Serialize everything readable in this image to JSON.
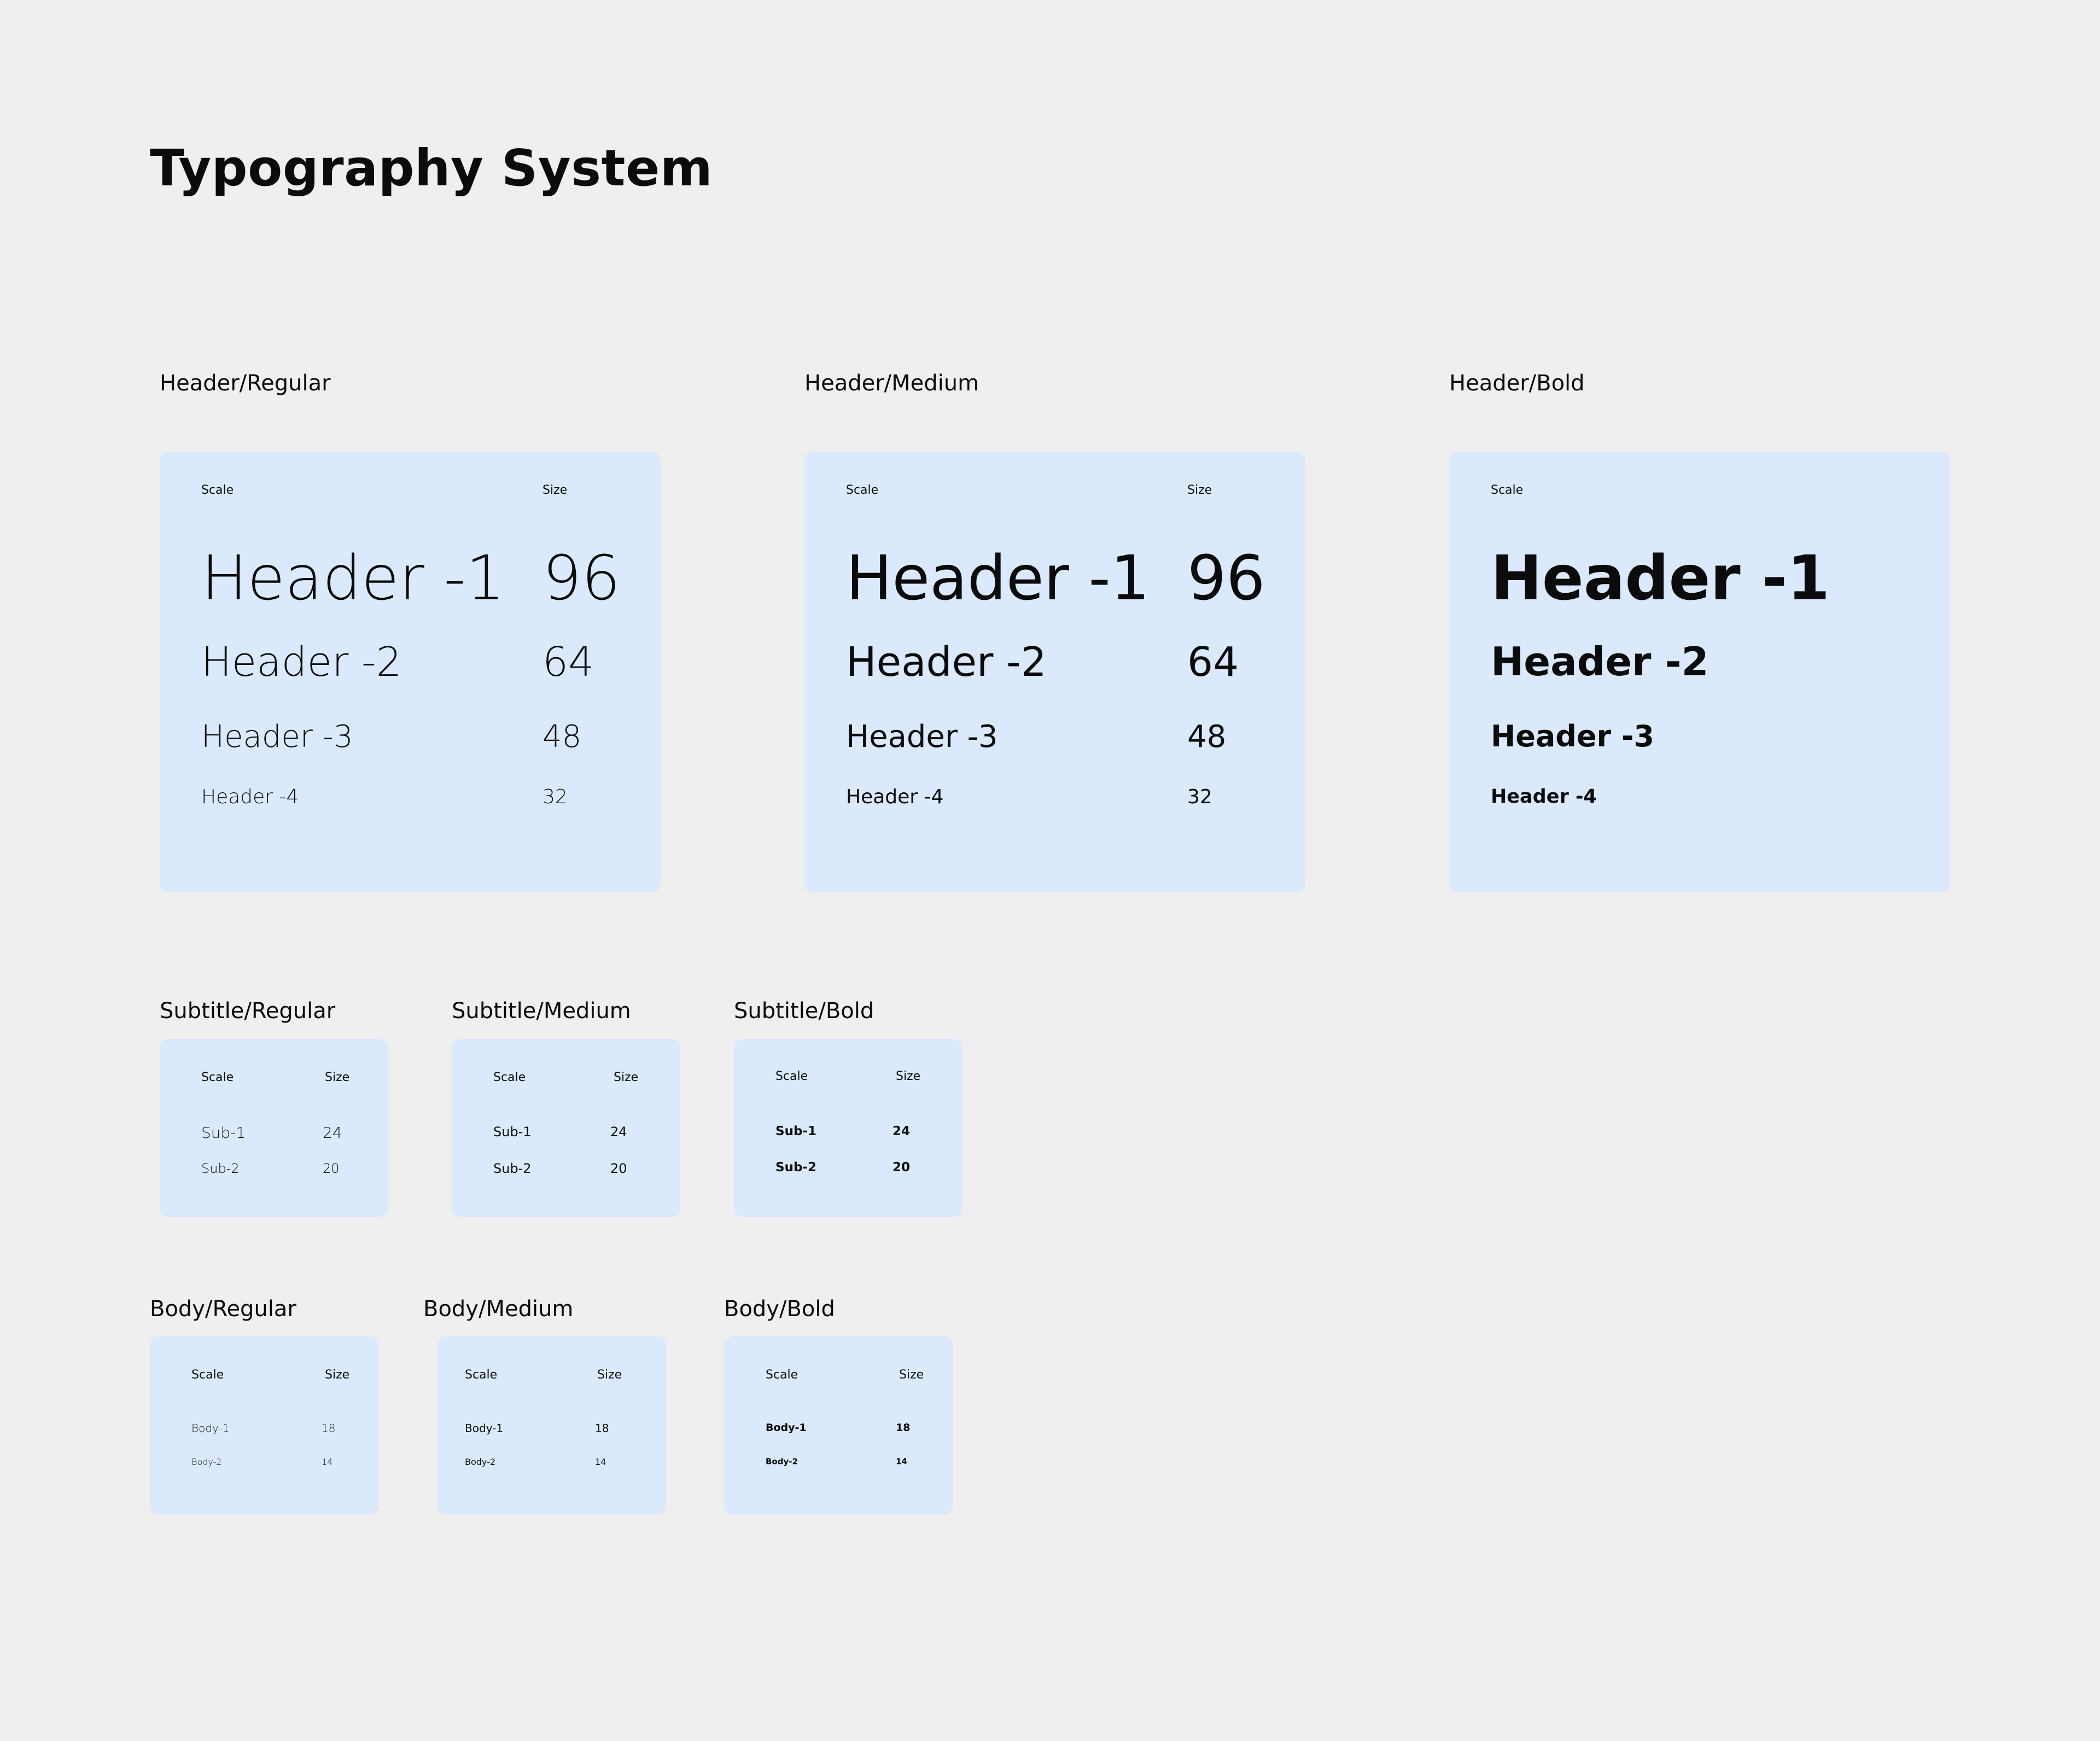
{
  "title": "Typography System",
  "header_sections": [
    {
      "label": "Header/Regular",
      "col_scale": "Scale",
      "col_size": "Size",
      "rows": [
        {
          "name": "Header -1",
          "size": "96"
        },
        {
          "name": "Header -2",
          "size": "64"
        },
        {
          "name": "Header -3",
          "size": "48"
        },
        {
          "name": "Header -4",
          "size": "32"
        }
      ]
    },
    {
      "label": "Header/Medium",
      "col_scale": "Scale",
      "col_size": "Size",
      "rows": [
        {
          "name": "Header -1",
          "size": "96"
        },
        {
          "name": "Header -2",
          "size": "64"
        },
        {
          "name": "Header -3",
          "size": "48"
        },
        {
          "name": "Header -4",
          "size": "32"
        }
      ]
    },
    {
      "label": "Header/Bold",
      "col_scale": "Scale",
      "rows": [
        {
          "name": "Header -1"
        },
        {
          "name": "Header -2"
        },
        {
          "name": "Header -3"
        },
        {
          "name": "Header -4"
        }
      ]
    }
  ],
  "subtitle_sections": [
    {
      "label": "Subtitle/Regular",
      "col_scale": "Scale",
      "col_size": "Size",
      "rows": [
        {
          "name": "Sub-1",
          "size": "24"
        },
        {
          "name": "Sub-2",
          "size": "20"
        }
      ]
    },
    {
      "label": "Subtitle/Medium",
      "col_scale": "Scale",
      "col_size": "Size",
      "rows": [
        {
          "name": "Sub-1",
          "size": "24"
        },
        {
          "name": "Sub-2",
          "size": "20"
        }
      ]
    },
    {
      "label": "Subtitle/Bold",
      "col_scale": "Scale",
      "col_size": "Size",
      "rows": [
        {
          "name": "Sub-1",
          "size": "24"
        },
        {
          "name": "Sub-2",
          "size": "20"
        }
      ]
    }
  ],
  "body_sections": [
    {
      "label": "Body/Regular",
      "col_scale": "Scale",
      "col_size": "Size",
      "rows": [
        {
          "name": "Body-1",
          "size": "18"
        },
        {
          "name": "Body-2",
          "size": "14"
        }
      ]
    },
    {
      "label": "Body/Medium",
      "col_scale": "Scale",
      "col_size": "Size",
      "rows": [
        {
          "name": "Body-1",
          "size": "18"
        },
        {
          "name": "Body-2",
          "size": "14"
        }
      ]
    },
    {
      "label": "Body/Bold",
      "col_scale": "Scale",
      "col_size": "Size",
      "rows": [
        {
          "name": "Body-1",
          "size": "18"
        },
        {
          "name": "Body-2",
          "size": "14"
        }
      ]
    }
  ]
}
